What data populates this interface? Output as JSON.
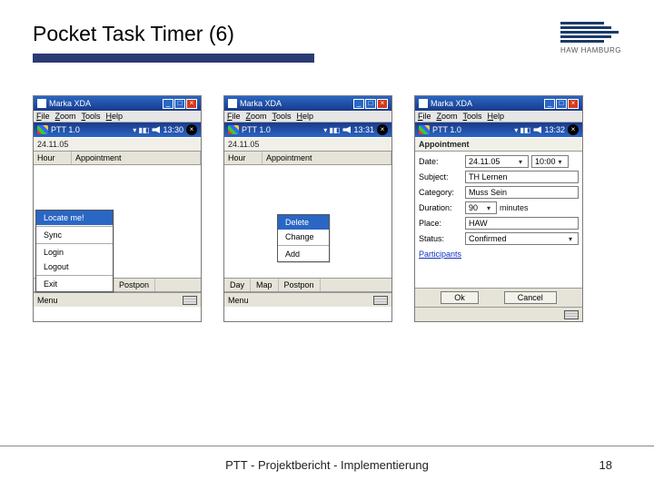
{
  "slide": {
    "title": "Pocket Task Timer (6)",
    "footer": "PTT - Projektbericht - Implementierung",
    "page_number": "18",
    "logo_label": "HAW HAMBURG"
  },
  "emu": {
    "window_title": "Marka XDA",
    "menu": {
      "file": "File",
      "zoom": "Zoom",
      "tools": "Tools",
      "help": "Help"
    },
    "ppc": {
      "app_title": "PTT 1.0",
      "appt_title": "Appointment",
      "signal": "▾ ▮◧",
      "speaker": "◀×",
      "time1": "13:30",
      "time2": "13:31",
      "time3": "13:32"
    },
    "date_bar": "24.11.05",
    "list_header": {
      "hour": "Hour",
      "appt": "Appointment"
    },
    "menu_label": "Menu",
    "sync_menu": {
      "locate": "Locate me!",
      "sync": "Sync",
      "login": "Login",
      "logout": "Logout",
      "exit": "Exit"
    },
    "ctx_menu": {
      "delete": "Delete",
      "change": "Change",
      "add": "Add"
    },
    "tabs": {
      "day": "Day",
      "map": "Map",
      "postpone": "Postpon"
    },
    "appt_form": {
      "date_lbl": "Date:",
      "date_val": "24.11.05",
      "time_val": "10:00",
      "subject_lbl": "Subject:",
      "subject_val": "TH Lernen",
      "category_lbl": "Category:",
      "category_val": "Muss Sein",
      "duration_lbl": "Duration:",
      "duration_val": "90",
      "duration_unit": "minutes",
      "place_lbl": "Place:",
      "place_val": "HAW",
      "status_lbl": "Status:",
      "status_val": "Confirmed",
      "participants": "Participants",
      "ok": "Ok",
      "cancel": "Cancel"
    }
  }
}
